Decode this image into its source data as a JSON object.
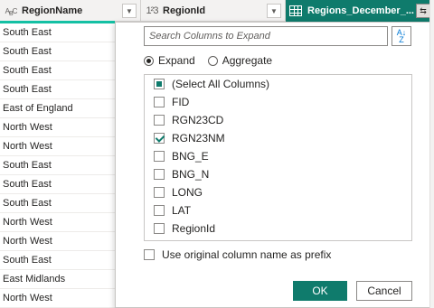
{
  "columns": [
    {
      "type_icon": "ABC",
      "title": "RegionName"
    },
    {
      "type_icon": "123",
      "title": "RegionId"
    },
    {
      "type_icon": "table-icon",
      "title": "Regions_December_..."
    }
  ],
  "rows": [
    "South East",
    "South East",
    "South East",
    "South East",
    "East of England",
    "North West",
    "North West",
    "South East",
    "South East",
    "South East",
    "North West",
    "North West",
    "South East",
    "East Midlands",
    "North West"
  ],
  "popup": {
    "search_placeholder": "Search Columns to Expand",
    "sort_icon": "sort-az-icon",
    "mode_options": [
      {
        "label": "Expand",
        "selected": true
      },
      {
        "label": "Aggregate",
        "selected": false
      }
    ],
    "columns": [
      {
        "label": "(Select All Columns)",
        "state": "partial"
      },
      {
        "label": "FID",
        "state": "unchecked"
      },
      {
        "label": "RGN23CD",
        "state": "unchecked"
      },
      {
        "label": "RGN23NM",
        "state": "checked"
      },
      {
        "label": "BNG_E",
        "state": "unchecked"
      },
      {
        "label": "BNG_N",
        "state": "unchecked"
      },
      {
        "label": "LONG",
        "state": "unchecked"
      },
      {
        "label": "LAT",
        "state": "unchecked"
      },
      {
        "label": "RegionId",
        "state": "unchecked"
      }
    ],
    "prefix_label": "Use original column name as prefix",
    "prefix_checked": false,
    "ok_label": "OK",
    "cancel_label": "Cancel"
  },
  "colors": {
    "accent": "#0f7b6c",
    "highlight": "#14c0a4"
  }
}
